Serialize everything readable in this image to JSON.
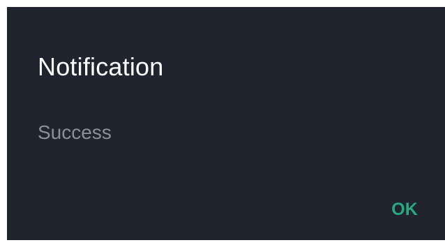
{
  "dialog": {
    "title": "Notification",
    "message": "Success",
    "ok_label": "OK"
  },
  "colors": {
    "background": "#20242f",
    "title": "#ffffff",
    "message": "#8a8f99",
    "accent": "#28a97f"
  }
}
